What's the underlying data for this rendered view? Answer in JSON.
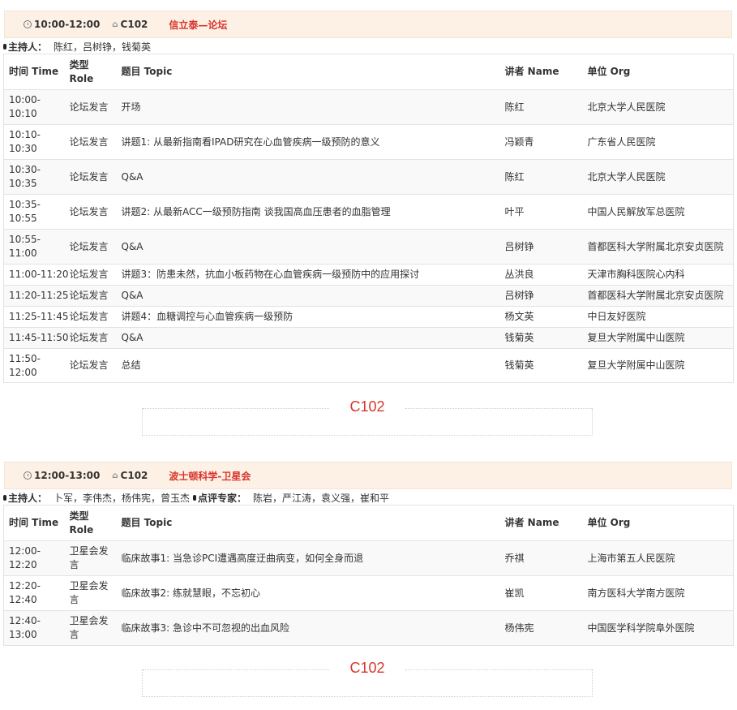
{
  "sessions": [
    {
      "time": "10:00-12:00",
      "room": "C102",
      "title": "信立泰—论坛",
      "hosts_label": "主持人：",
      "hosts": "陈红，吕树铮，钱菊英",
      "reviewers_label": "",
      "reviewers": "",
      "columns": [
        "时间 Time",
        "类型 Role",
        "题目 Topic",
        "讲者 Name",
        "单位 Org"
      ],
      "rows": [
        {
          "time": "10:00-10:10",
          "role": "论坛发言",
          "topic": "开场",
          "name": "陈红",
          "org": "北京大学人民医院"
        },
        {
          "time": "10:10-10:30",
          "role": "论坛发言",
          "topic": "讲题1: 从最新指南看IPAD研究在心血管疾病一级预防的意义",
          "name": "冯颖青",
          "org": "广东省人民医院"
        },
        {
          "time": "10:30-10:35",
          "role": "论坛发言",
          "topic": "Q&A",
          "name": "陈红",
          "org": "北京大学人民医院"
        },
        {
          "time": "10:35-10:55",
          "role": "论坛发言",
          "topic": "讲题2: 从最新ACC一级预防指南 谈我国高血压患者的血脂管理",
          "name": "叶平",
          "org": "中国人民解放军总医院"
        },
        {
          "time": "10:55-11:00",
          "role": "论坛发言",
          "topic": "Q&A",
          "name": "吕树铮",
          "org": "首都医科大学附属北京安贞医院"
        },
        {
          "time": "11:00-11:20",
          "role": "论坛发言",
          "topic": "讲题3：防患未然，抗血小板药物在心血管疾病一级预防中的应用探讨",
          "name": "丛洪良",
          "org": "天津市胸科医院心内科"
        },
        {
          "time": "11:20-11:25",
          "role": "论坛发言",
          "topic": "Q&A",
          "name": "吕树铮",
          "org": "首都医科大学附属北京安贞医院"
        },
        {
          "time": "11:25-11:45",
          "role": "论坛发言",
          "topic": "讲题4：血糖调控与心血管疾病一级预防",
          "name": "杨文英",
          "org": "中日友好医院"
        },
        {
          "time": "11:45-11:50",
          "role": "论坛发言",
          "topic": "Q&A",
          "name": "钱菊英",
          "org": "复旦大学附属中山医院"
        },
        {
          "time": "11:50-12:00",
          "role": "论坛发言",
          "topic": "总结",
          "name": "钱菊英",
          "org": "复旦大学附属中山医院"
        }
      ],
      "room_footer": "C102"
    },
    {
      "time": "12:00-13:00",
      "room": "C102",
      "title": "波士顿科学-卫星会",
      "hosts_label": "主持人：",
      "hosts": "卜军，李伟杰，杨伟宪，曾玉杰",
      "reviewers_label": "点评专家：",
      "reviewers": "陈岩，严江涛，袁义强，崔和平",
      "columns": [
        "时间 Time",
        "类型 Role",
        "题目 Topic",
        "讲者 Name",
        "单位 Org"
      ],
      "rows": [
        {
          "time": "12:00-12:20",
          "role": "卫星会发言",
          "topic": "临床故事1: 当急诊PCI遭遇高度迂曲病变，如何全身而退",
          "name": "乔祺",
          "org": "上海市第五人民医院"
        },
        {
          "time": "12:20-12:40",
          "role": "卫星会发言",
          "topic": "临床故事2: 练就慧眼，不忘初心",
          "name": "崔凯",
          "org": "南方医科大学南方医院"
        },
        {
          "time": "12:40-13:00",
          "role": "卫星会发言",
          "topic": "临床故事3: 急诊中不可忽视的出血风险",
          "name": "杨伟宪",
          "org": "中国医学科学院阜外医院"
        }
      ],
      "room_footer": "C102"
    }
  ]
}
